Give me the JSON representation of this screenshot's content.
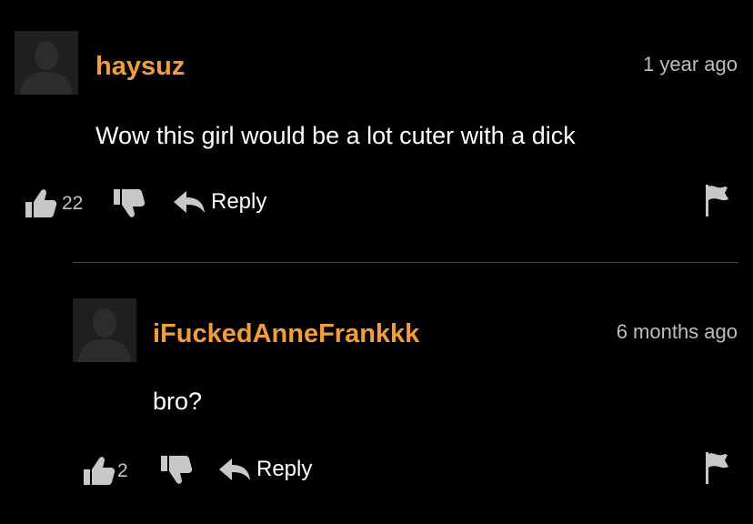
{
  "comments": [
    {
      "username": "haysuz",
      "time": "1 year ago",
      "text": "Wow this girl would be a lot cuter with a dick",
      "likes": "22",
      "reply_label": "Reply"
    },
    {
      "username": "iFuckedAnneFrankkk",
      "time": "6 months ago",
      "text": "bro?",
      "likes": "2",
      "reply_label": "Reply"
    }
  ],
  "colors": {
    "background": "#000000",
    "username": "#f39c3c",
    "timestamp": "#bdbdbd",
    "icon": "#c8c8c8",
    "divider": "#454545"
  },
  "icons": [
    "avatar-placeholder",
    "thumbs-up-icon",
    "thumbs-down-icon",
    "reply-arrow-icon",
    "flag-icon"
  ]
}
